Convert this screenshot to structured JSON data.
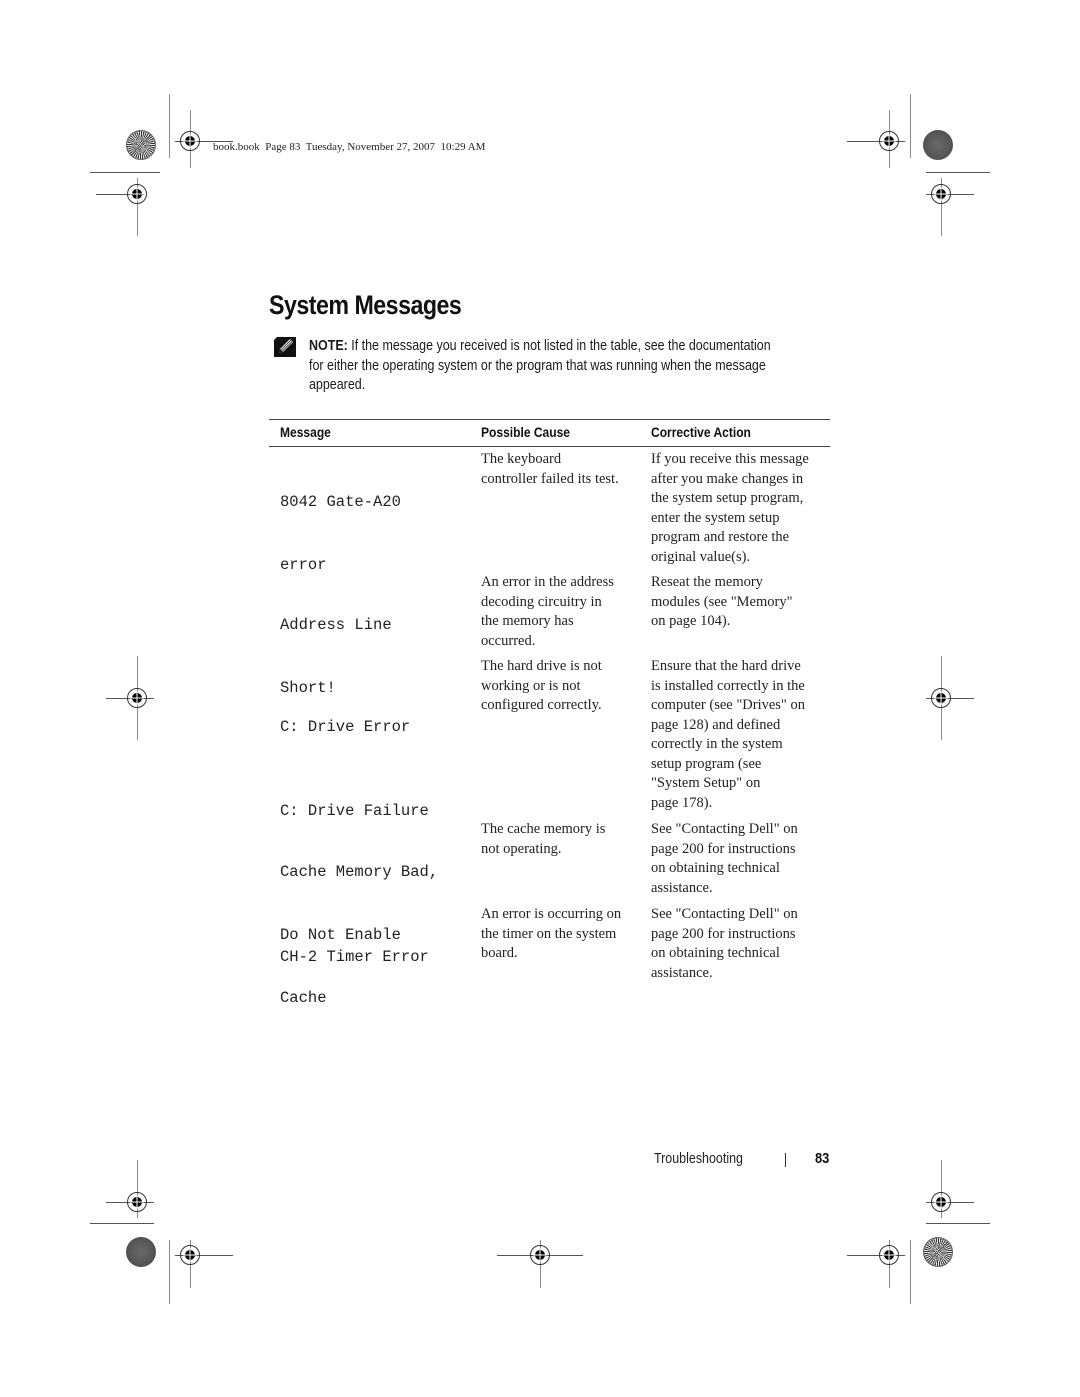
{
  "slug": "book.book  Page 83  Tuesday, November 27, 2007  10:29 AM",
  "title": "System Messages",
  "note": {
    "icon": "note-pencil-icon",
    "label": "NOTE:",
    "lines": [
      " If the message you received is not listed in the table, see the documentation",
      "for either the operating system or the program that was running when the message",
      "appeared."
    ]
  },
  "table": {
    "headers": {
      "message": "Message",
      "cause": "Possible Cause",
      "action": "Corrective Action"
    },
    "rows": [
      {
        "message": [
          "8042 Gate-A20",
          "error"
        ],
        "cause": [
          "The keyboard",
          "controller failed its test."
        ],
        "action": [
          "If you receive this message",
          "after you make changes in",
          "the system setup program,",
          "enter the system setup",
          "program and restore the",
          "original value(s)."
        ]
      },
      {
        "message": [
          "Address Line",
          "Short!"
        ],
        "cause": [
          "An error in the address",
          "decoding circuitry in",
          "the memory has",
          "occurred."
        ],
        "action": [
          "Reseat the memory",
          "modules (see \"Memory\"",
          "on page 104)."
        ]
      },
      {
        "message": [
          "C: Drive Error",
          "C: Drive Failure"
        ],
        "cause": [
          "The hard drive is not",
          "working or is not",
          "configured correctly."
        ],
        "action": [
          "Ensure that the hard drive",
          "is installed correctly in the",
          "computer (see \"Drives\" on",
          "page 128) and defined",
          "correctly in the system",
          "setup program (see",
          "\"System Setup\" on",
          "page 178)."
        ]
      },
      {
        "message": [
          "Cache Memory Bad,",
          "Do Not Enable",
          "Cache"
        ],
        "cause": [
          "The cache memory is",
          "not operating."
        ],
        "action": [
          "See \"Contacting Dell\" on",
          "page 200 for instructions",
          "on obtaining technical",
          "assistance."
        ]
      },
      {
        "message": [
          "CH-2 Timer Error"
        ],
        "cause": [
          "An error is occurring on",
          "the timer on the system",
          "board."
        ],
        "action": [
          "See \"Contacting Dell\" on",
          "page 200 for instructions",
          "on obtaining technical",
          "assistance."
        ]
      }
    ]
  },
  "footer": {
    "section": "Troubleshooting",
    "page_number": "83"
  }
}
